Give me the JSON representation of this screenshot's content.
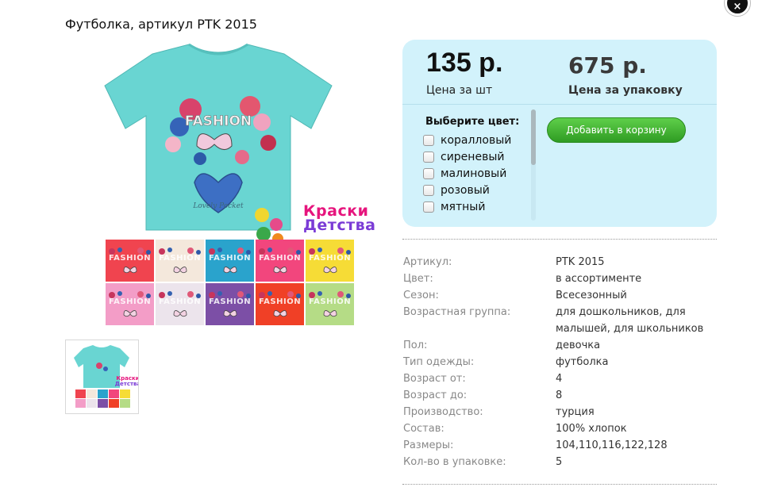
{
  "product": {
    "title": "Футболка, артикул PTK 2015"
  },
  "close_label": "×",
  "brand": {
    "line1": "Краски",
    "line2": "Детства"
  },
  "swatch_text": "FASHION",
  "swatch_colors": [
    "#f0444f",
    "#f4e8dc",
    "#2aa3cc",
    "#f2467d",
    "#f6dc36",
    "#f39dc7",
    "#ece4ec",
    "#7c4fa6",
    "#f04026",
    "#b5dc86"
  ],
  "shirt_color": "#69d5d2",
  "price": {
    "unit_value": "135 р.",
    "unit_label": "Цена за шт",
    "pack_value": "675 р.",
    "pack_label": "Цена за упаковку"
  },
  "color_select": {
    "title": "Выберите цвет:",
    "options": [
      "коралловый",
      "сиреневый",
      "малиновый",
      "розовый",
      "мятный"
    ]
  },
  "add_to_cart_label": "Добавить в корзину",
  "specs": [
    {
      "k": "Артикул:",
      "v": "PTK 2015"
    },
    {
      "k": "Цвет:",
      "v": "в ассортименте"
    },
    {
      "k": "Сезон:",
      "v": "Всесезонный"
    },
    {
      "k": "Возрастная группа:",
      "v": "для дошкольников, для малышей, для школьников"
    },
    {
      "k": "Пол:",
      "v": "девочка"
    },
    {
      "k": "Тип одежды:",
      "v": "футболка"
    },
    {
      "k": "Возраст от:",
      "v": "4"
    },
    {
      "k": "Возраст до:",
      "v": "8"
    },
    {
      "k": "Производство:",
      "v": "турция"
    },
    {
      "k": "Состав:",
      "v": "100% хлопок"
    },
    {
      "k": "Размеры:",
      "v": "104,110,116,122,128"
    },
    {
      "k": "Кол-во в упаковке:",
      "v": "5"
    }
  ]
}
